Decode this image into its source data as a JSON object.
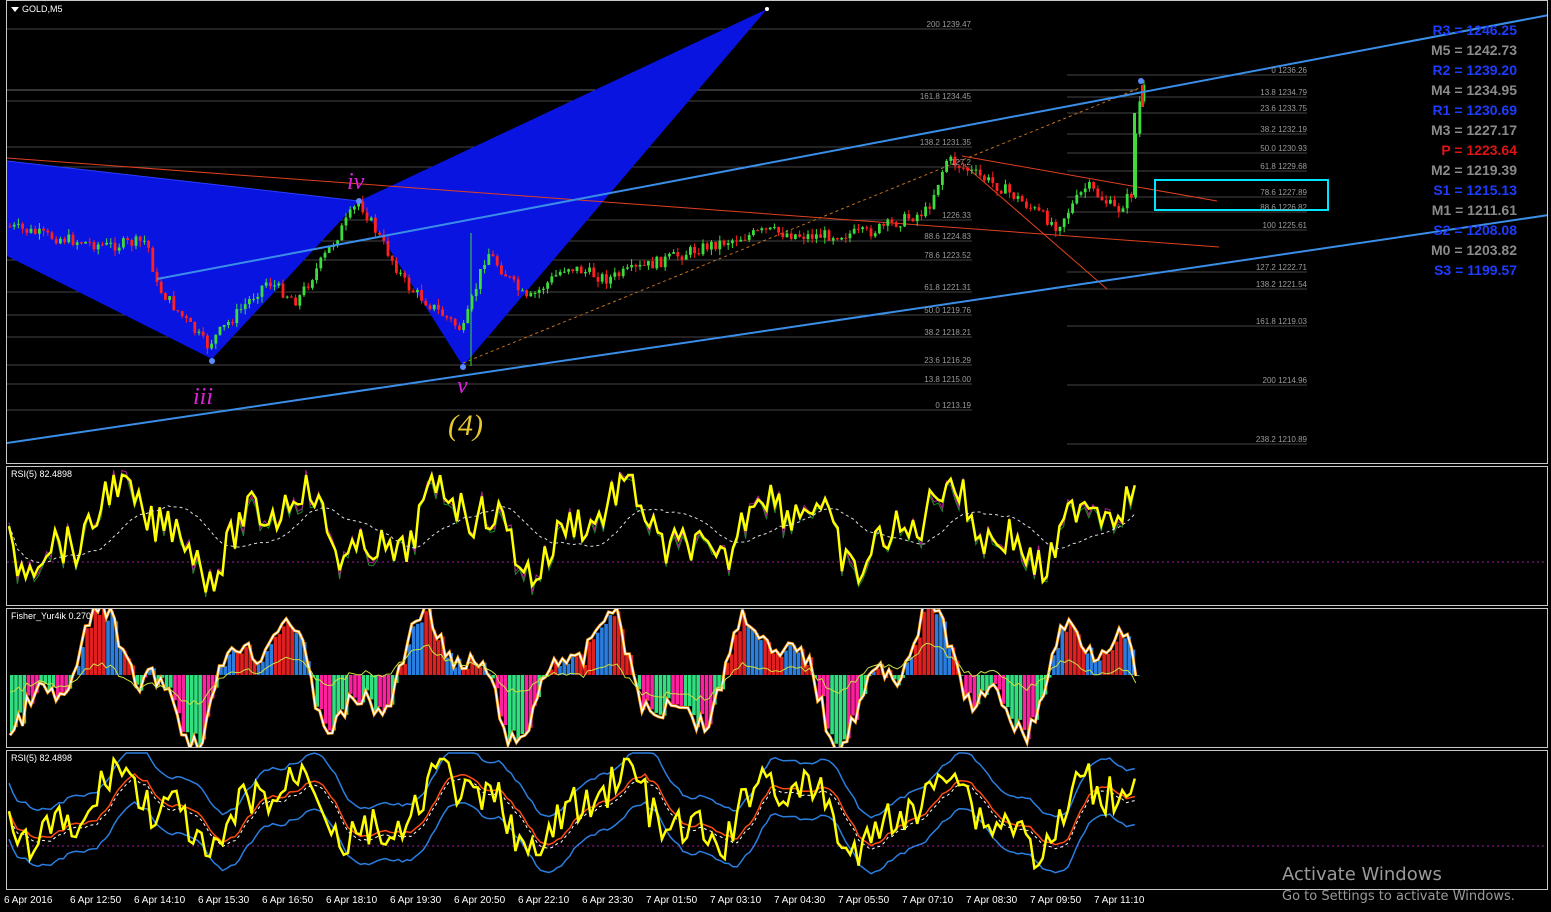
{
  "main_chart": {
    "symbol": "GOLD,M5",
    "pivots": [
      {
        "label": "R3 = 1246.25",
        "color": "#1e3cff"
      },
      {
        "label": "M5 = 1242.73",
        "color": "#8a8a8a"
      },
      {
        "label": "R2 = 1239.20",
        "color": "#1e3cff"
      },
      {
        "label": "M4 = 1234.95",
        "color": "#8a8a8a"
      },
      {
        "label": "R1 = 1230.69",
        "color": "#1e3cff"
      },
      {
        "label": "M3 = 1227.17",
        "color": "#8a8a8a"
      },
      {
        "label": "P = 1223.64",
        "color": "#e01414"
      },
      {
        "label": "M2 = 1219.39",
        "color": "#8a8a8a"
      },
      {
        "label": "S1 = 1215.13",
        "color": "#1e3cff"
      },
      {
        "label": "M1 = 1211.61",
        "color": "#8a8a8a"
      },
      {
        "label": "S2 = 1208.08",
        "color": "#1e3cff"
      },
      {
        "label": "M0 = 1203.82",
        "color": "#8a8a8a"
      },
      {
        "label": "S3 = 1199.57",
        "color": "#1e3cff"
      }
    ],
    "fib_left": [
      "200 1239.47",
      "161.8 1234.45",
      "138.2 1231.35",
      "127.2",
      "1226.33",
      "88.6 1224.83",
      "78.6 1223.52",
      "61.8 1221.31",
      "50.0 1219.76",
      "38.2 1218.21",
      "23.6 1216.29",
      "13.8 1215.00",
      "0 1213.19"
    ],
    "fib_right": [
      "0 1236.26",
      "13.8 1234.79",
      "23.6 1233.75",
      "38.2 1232.19",
      "50.0 1230.93",
      "61.8 1229.68",
      "78.6 1227.89",
      "88.6 1226.82",
      "100 1225.61",
      "127.2 1222.71",
      "138.2 1221.54",
      "161.8 1219.03",
      "200 1214.96",
      "238.2 1210.89"
    ],
    "waves": {
      "iii": "iii",
      "iv": "iv",
      "v": "v",
      "w4": "(4)"
    },
    "colors": {
      "bull": "#3ddc3d",
      "bear": "#ff2020",
      "channel": "#3a8ee8",
      "harmonic": "#0a14e0",
      "highlight": "#00e5ff"
    }
  },
  "indicators": {
    "rsi_top": "RSI(5) 82.4898",
    "fisher": "Fisher_Yur4ik 0.270",
    "rsi_bottom": "RSI(5) 82.4898"
  },
  "time_axis": [
    "6 Apr 2016",
    "6 Apr 12:50",
    "6 Apr 14:10",
    "6 Apr 15:30",
    "6 Apr 16:50",
    "6 Apr 18:10",
    "6 Apr 19:30",
    "6 Apr 20:50",
    "6 Apr 22:10",
    "6 Apr 23:30",
    "7 Apr 01:50",
    "7 Apr 03:10",
    "7 Apr 04:30",
    "7 Apr 05:50",
    "7 Apr 07:10",
    "7 Apr 08:30",
    "7 Apr 09:50",
    "7 Apr 11:10"
  ],
  "watermark": {
    "title": "Activate Windows",
    "subtitle": "Go to Settings to activate Windows."
  }
}
